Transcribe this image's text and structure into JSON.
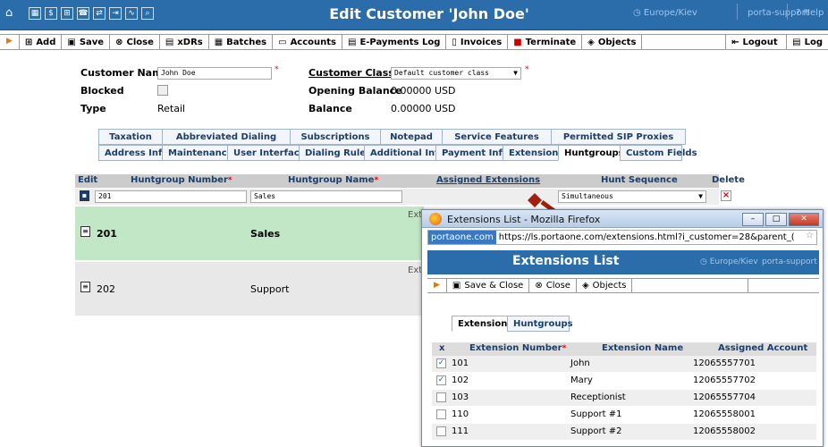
{
  "header": {
    "title": "Edit Customer 'John Doe'",
    "timezone": "Europe/Kiev",
    "user": "porta-support",
    "help": "Help"
  },
  "toolbar": {
    "add": "Add",
    "save": "Save",
    "close": "Close",
    "xdrs": "xDRs",
    "batches": "Batches",
    "accounts": "Accounts",
    "epayments": "E-Payments Log",
    "invoices": "Invoices",
    "terminate": "Terminate",
    "objects": "Objects",
    "logout": "Logout",
    "log": "Log"
  },
  "form": {
    "customer_name_label": "Customer Name",
    "customer_name_value": "John Doe",
    "blocked_label": "Blocked",
    "type_label": "Type",
    "type_value": "Retail",
    "customer_class_label": "Customer Class",
    "customer_class_value": "Default customer class",
    "opening_balance_label": "Opening Balance",
    "opening_balance_value": "0.00000 USD",
    "balance_label": "Balance",
    "balance_value": "0.00000 USD"
  },
  "tabs_row1": [
    "Taxation",
    "Abbreviated Dialing",
    "Subscriptions",
    "Notepad",
    "Service Features",
    "Permitted SIP Proxies"
  ],
  "tabs_row2": [
    "Address Info",
    "Maintenance",
    "User Interface",
    "Dialing Rules",
    "Additional Info",
    "Payment Info",
    "Extensions",
    "Huntgroups",
    "Custom Fields"
  ],
  "huntgroups": {
    "headers": {
      "edit": "Edit",
      "number": "Huntgroup Number",
      "name": "Huntgroup Name",
      "assigned": "Assigned Extensions",
      "sequence": "Hunt Sequence",
      "delete": "Delete"
    },
    "edit_row": {
      "number": "201",
      "name": "Sales",
      "sequence": "Simultaneous"
    },
    "rows": [
      {
        "number": "201",
        "name": "Sales",
        "ext_label": "Ext"
      },
      {
        "number": "202",
        "name": "Support",
        "ext_label": "Ext"
      }
    ]
  },
  "popup": {
    "window_title": "Extensions List - Mozilla Firefox",
    "url_site": "portaone.com",
    "url": "https://ls.portaone.com/extensions.html?i_customer=28&parent_(",
    "title": "Extensions List",
    "timezone": "Europe/Kiev",
    "user": "porta-support",
    "toolbar": {
      "save_close": "Save & Close",
      "close": "Close",
      "objects": "Objects"
    },
    "tabs": [
      "Extensions",
      "Huntgroups"
    ],
    "headers": {
      "x": "x",
      "number": "Extension Number",
      "name": "Extension Name",
      "account": "Assigned Account"
    },
    "rows": [
      {
        "checked": true,
        "number": "101",
        "name": "John",
        "account": "12065557701"
      },
      {
        "checked": true,
        "number": "102",
        "name": "Mary",
        "account": "12065557702"
      },
      {
        "checked": false,
        "number": "103",
        "name": "Receptionist",
        "account": "12065557704"
      },
      {
        "checked": false,
        "number": "110",
        "name": "Support #1",
        "account": "12065558001"
      },
      {
        "checked": false,
        "number": "111",
        "name": "Support #2",
        "account": "12065558002"
      }
    ]
  }
}
